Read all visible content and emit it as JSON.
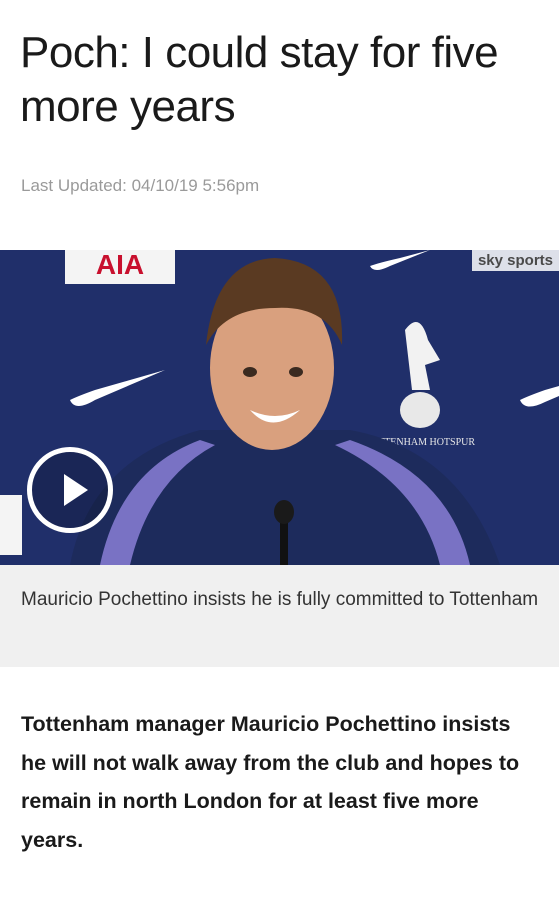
{
  "article": {
    "headline": "Poch: I could stay for five more years",
    "last_updated": "Last Updated: 04/10/19 5:56pm",
    "media": {
      "channel_logo": "sky sports",
      "backdrop_sponsor": "AIA",
      "backdrop_crest_text": "TOTTENHAM HOTSPUR",
      "play_icon": "play-icon"
    },
    "caption": "Mauricio Pochettino insists he is fully committed to Tottenham",
    "lead": "Tottenham manager Mauricio Pochettino insists he will not walk away from the club and hopes to remain in north London for at least five more years."
  },
  "colors": {
    "backdrop": "#1c2a63",
    "caption_background": "#f0f0f0",
    "muted_text": "#9a9a9a",
    "body_text": "#1a1a1a"
  }
}
